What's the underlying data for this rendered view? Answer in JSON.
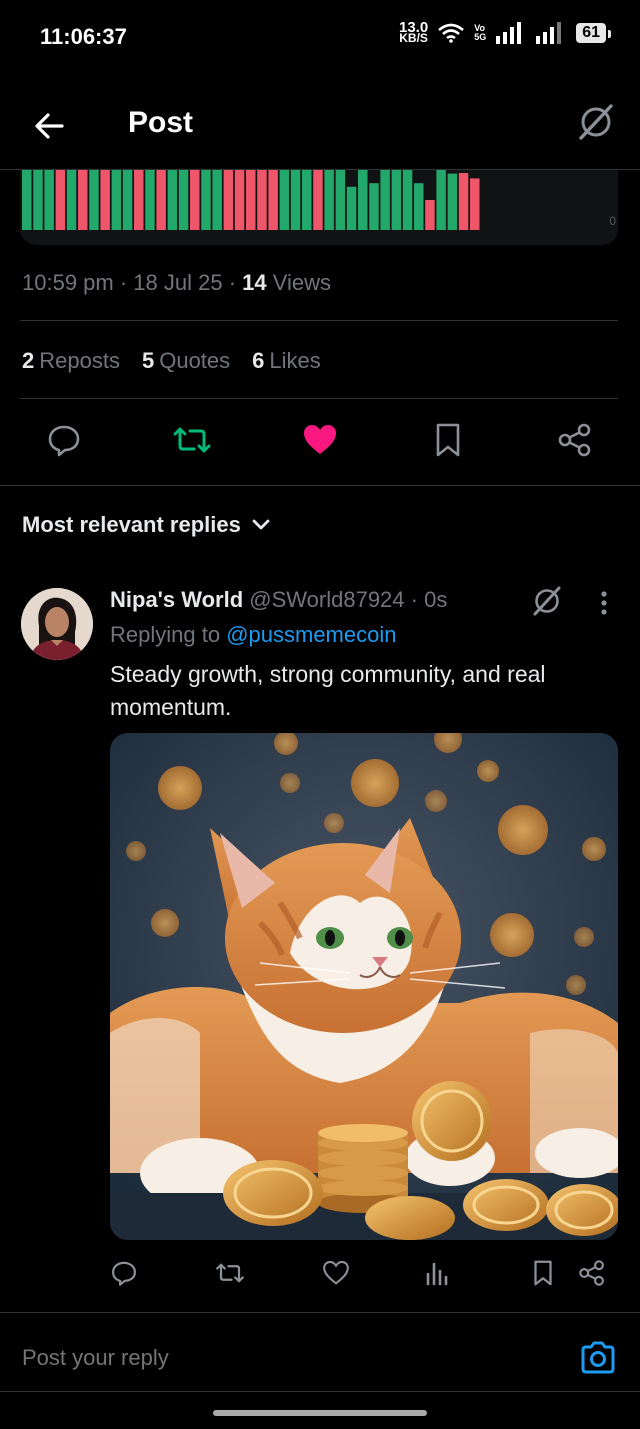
{
  "status_bar": {
    "time": "11:06:37",
    "net_speed_value": "13.0",
    "net_speed_unit": "KB/S",
    "volte_top": "Vo",
    "volte_bottom": "5G",
    "battery": "61"
  },
  "header": {
    "title": "Post"
  },
  "chart_fragment": {
    "axis_label": "0",
    "bar_colors": [
      "green",
      "green",
      "green",
      "red",
      "green",
      "red",
      "green",
      "red",
      "green",
      "green",
      "red",
      "green",
      "red",
      "green",
      "green",
      "red",
      "green",
      "green",
      "red",
      "red",
      "red",
      "red",
      "red",
      "green",
      "green",
      "green",
      "red",
      "green",
      "green",
      "green",
      "green",
      "green",
      "green",
      "green",
      "green",
      "green",
      "red",
      "green",
      "green",
      "red",
      "red"
    ],
    "bar_levels": [
      1,
      1,
      1,
      1,
      1,
      1,
      1,
      1,
      1,
      1,
      1,
      1,
      1,
      1,
      1,
      1,
      1,
      1,
      1,
      1,
      1,
      1,
      1,
      1,
      1,
      1,
      1,
      1,
      1,
      0.72,
      1,
      0.78,
      1,
      1,
      1,
      0.78,
      0.5,
      1,
      0.94,
      0.95,
      0.86
    ]
  },
  "post_meta": {
    "time": "10:59 pm",
    "sep1": " · ",
    "date": "18 Jul 25",
    "sep2": " · ",
    "views_count": "14",
    "views_label": " Views"
  },
  "stats": {
    "reposts_count": "2",
    "reposts_label": "Reposts",
    "quotes_count": "5",
    "quotes_label": "Quotes",
    "likes_count": "6",
    "likes_label": "Likes"
  },
  "colors": {
    "retweet_active": "#00ba7c",
    "like_active": "#f91880",
    "link": "#1d9bf0",
    "chart_green": "#23a86b",
    "chart_red": "#f0566a"
  },
  "replies": {
    "sort_label": "Most relevant replies",
    "items": [
      {
        "display_name": "Nipa's World",
        "handle": "@SWorld87924",
        "time": " · 0s",
        "replying_prefix": "Replying to ",
        "replying_to": "@pussmemecoin",
        "text": "Steady growth, strong community, and real momentum."
      }
    ]
  },
  "composer": {
    "placeholder": "Post your reply"
  },
  "icons": [
    "back-arrow-icon",
    "grok-icon",
    "reply-icon",
    "retweet-icon",
    "heart-icon",
    "bookmark-icon",
    "share-icon",
    "chevron-down-icon",
    "more-icon",
    "views-icon",
    "camera-icon"
  ]
}
